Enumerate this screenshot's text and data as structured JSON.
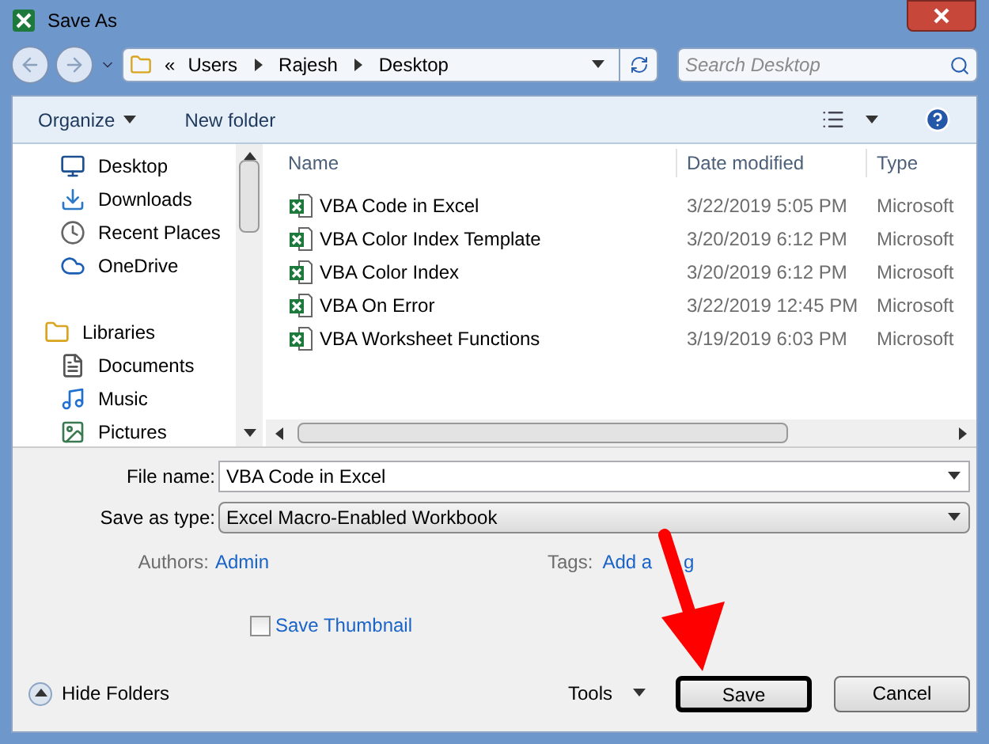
{
  "window": {
    "title": "Save As"
  },
  "breadcrumb": {
    "overflow": "«",
    "parts": [
      "Users",
      "Rajesh",
      "Desktop"
    ]
  },
  "search": {
    "placeholder": "Search Desktop"
  },
  "toolbar": {
    "organize": "Organize",
    "new_folder": "New folder"
  },
  "nav": [
    {
      "label": "Desktop",
      "kind": "desktop"
    },
    {
      "label": "Downloads",
      "kind": "downloads"
    },
    {
      "label": "Recent Places",
      "kind": "recent"
    },
    {
      "label": "OneDrive",
      "kind": "cloud"
    },
    {
      "label": "Libraries",
      "kind": "library",
      "children": [
        {
          "label": "Documents",
          "kind": "documents"
        },
        {
          "label": "Music",
          "kind": "music"
        },
        {
          "label": "Pictures",
          "kind": "pictures"
        }
      ]
    }
  ],
  "files": {
    "columns": [
      "Name",
      "Date modified",
      "Type"
    ],
    "rows": [
      {
        "name": "VBA Code in Excel",
        "date": "3/22/2019 5:05 PM",
        "type": "Microsoft"
      },
      {
        "name": "VBA Color Index Template",
        "date": "3/20/2019 6:12 PM",
        "type": "Microsoft"
      },
      {
        "name": "VBA Color Index",
        "date": "3/20/2019 6:12 PM",
        "type": "Microsoft"
      },
      {
        "name": "VBA On Error",
        "date": "3/22/2019 12:45 PM",
        "type": "Microsoft"
      },
      {
        "name": "VBA Worksheet Functions",
        "date": "3/19/2019 6:03 PM",
        "type": "Microsoft"
      }
    ]
  },
  "form": {
    "file_name": {
      "label": "File name:",
      "value": "VBA Code in Excel"
    },
    "save_type": {
      "label": "Save as type:",
      "value": "Excel Macro-Enabled Workbook"
    },
    "authors": {
      "label": "Authors:",
      "value": "Admin"
    },
    "tags": {
      "label": "Tags:",
      "value": "Add a",
      "tail": "g"
    },
    "thumbnail": {
      "label": "Save Thumbnail",
      "checked": false
    }
  },
  "footer": {
    "hide_folders": "Hide Folders",
    "tools": "Tools",
    "save": "Save",
    "save_highlighted": true,
    "cancel": "Cancel"
  }
}
